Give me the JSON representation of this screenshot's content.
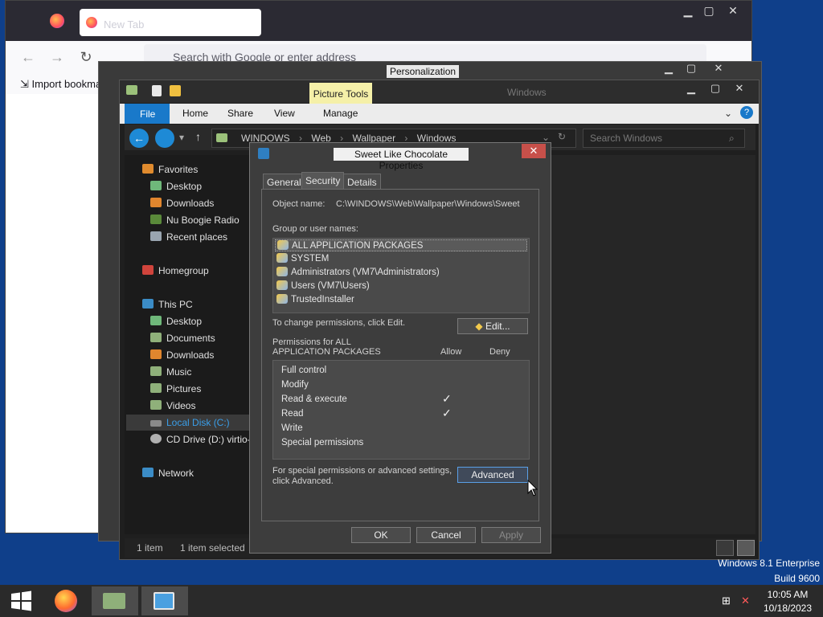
{
  "firefox": {
    "tab_title": "New Tab",
    "url_placeholder": "Search with Google or enter address",
    "bookmark_item": "Import bookmarks..."
  },
  "personalization": {
    "title": "Personalization"
  },
  "explorer": {
    "title": "Windows",
    "context_tab": "Picture Tools",
    "tabs": {
      "file": "File",
      "home": "Home",
      "share": "Share",
      "view": "View",
      "manage": "Manage"
    },
    "breadcrumb": [
      "WINDOWS",
      "Web",
      "Wallpaper",
      "Windows"
    ],
    "search_placeholder": "Search Windows",
    "nav": {
      "favorites": "Favorites",
      "fav_items": [
        "Desktop",
        "Downloads",
        "Nu Boogie Radio",
        "Recent places"
      ],
      "homegroup": "Homegroup",
      "thispc": "This PC",
      "pc_items": [
        "Desktop",
        "Documents",
        "Downloads",
        "Music",
        "Pictures",
        "Videos",
        "Local Disk (C:)",
        "CD Drive (D:) virtio-"
      ],
      "network": "Network"
    },
    "status": {
      "count": "1 item",
      "selected": "1 item selected"
    }
  },
  "dialog": {
    "title": "Sweet Like Chocolate Properties",
    "tabs": [
      "General",
      "Security",
      "Details"
    ],
    "object_label": "Object name:",
    "object_value": "C:\\WINDOWS\\Web\\Wallpaper\\Windows\\Sweet",
    "group_label": "Group or user names:",
    "groups": [
      "ALL APPLICATION PACKAGES",
      "SYSTEM",
      "Administrators (VM7\\Administrators)",
      "Users (VM7\\Users)",
      "TrustedInstaller"
    ],
    "change_text": "To change permissions, click Edit.",
    "edit_button": "Edit...",
    "perm_label_1": "Permissions for ALL",
    "perm_label_2": "APPLICATION PACKAGES",
    "allow": "Allow",
    "deny": "Deny",
    "permissions": [
      "Full control",
      "Modify",
      "Read & execute",
      "Read",
      "Write",
      "Special permissions"
    ],
    "check_mark": "✓",
    "special_text_1": "For special permissions or advanced settings,",
    "special_text_2": "click Advanced.",
    "advanced_button": "Advanced",
    "ok_button": "OK",
    "cancel_button": "Cancel",
    "apply_button": "Apply"
  },
  "desktop": {
    "edition": "Windows 8.1 Enterprise",
    "build": "Build 9600"
  },
  "taskbar": {
    "time": "10:05 AM",
    "date": "10/18/2023"
  }
}
